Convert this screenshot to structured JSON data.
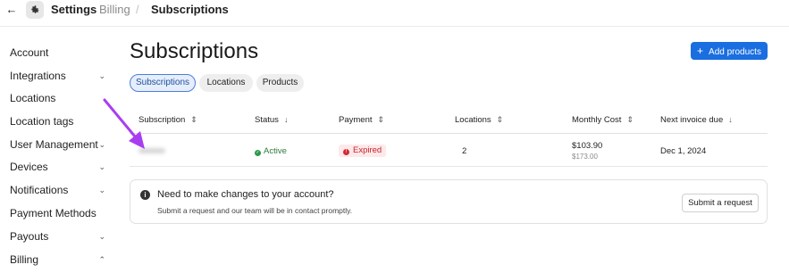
{
  "header": {
    "breadcrumb": [
      "Settings",
      "Billing",
      "/",
      "Subscriptions"
    ]
  },
  "sidebar": {
    "items": [
      {
        "label": "Account",
        "chevron": ""
      },
      {
        "label": "Integrations",
        "chevron": "⌄"
      },
      {
        "label": "Locations",
        "chevron": ""
      },
      {
        "label": "Location tags",
        "chevron": ""
      },
      {
        "label": "User Management",
        "chevron": "⌄"
      },
      {
        "label": "Devices",
        "chevron": "⌄"
      },
      {
        "label": "Notifications",
        "chevron": "⌄"
      },
      {
        "label": "Payment Methods",
        "chevron": ""
      },
      {
        "label": "Payouts",
        "chevron": "⌄"
      },
      {
        "label": "Billing",
        "chevron": "⌃"
      }
    ]
  },
  "main": {
    "title": "Subscriptions",
    "add_button": "Add products",
    "tabs": [
      "Subscriptions",
      "Locations",
      "Products"
    ],
    "table": {
      "columns": [
        "Subscription",
        "Status",
        "Payment",
        "Locations",
        "Monthly Cost",
        "Next invoice due"
      ],
      "rows": [
        {
          "status": "Active",
          "payment": "Expired",
          "locations": "2",
          "monthly_cost": "$103.90",
          "monthly_cost_sub": "$173.00",
          "next_invoice": "Dec 1, 2024"
        }
      ]
    },
    "notice": {
      "title": "Need to make changes to your account?",
      "body": "Submit a request and our team will be in contact promptly.",
      "button": "Submit a request"
    }
  },
  "colors": {
    "accent": "#1a6ee0",
    "active_green": "#2c7a3a",
    "expired_red": "#c4242b",
    "annotation_arrow": "#a93ef0"
  }
}
